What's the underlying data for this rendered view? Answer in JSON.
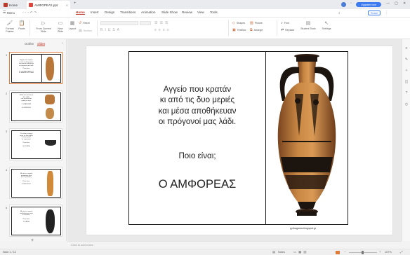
{
  "titlebar": {
    "home_tab": "Home",
    "doc_tab": "ΑΜΦΟΡΕΑΣ.ppt",
    "upgrade": "Upgrade now",
    "colors": {
      "accent": "#c0392b",
      "doc_icon": "#e0443b",
      "upgrade_bg": "#3c7bf0"
    }
  },
  "menubar": {
    "menu": "Menu",
    "tabs": [
      "Home",
      "Insert",
      "Design",
      "Transitions",
      "Animation",
      "Slide Show",
      "Review",
      "View",
      "Tools"
    ],
    "active_tab": "Home",
    "share": "Share"
  },
  "ribbon": {
    "format_painter": "Format Painter",
    "paste": "Paste",
    "from_current_slide": "From Current Slide",
    "new_slide": "New Slide",
    "layout": "Layout",
    "reset": "Reset",
    "section": "Section",
    "shapes": "Shapes",
    "textbox": "TextBox",
    "picture": "Picture",
    "arrange": "Arrange",
    "find": "Find",
    "replace": "Replace",
    "student_tools": "Student Tools",
    "settings": "Settings"
  },
  "leftpanel": {
    "tabs": [
      "Outline",
      "Slides"
    ],
    "active_tab": "Slides",
    "thumbnails": [
      {
        "num": "1",
        "lines": [
          "Αγγείο που κρατάν",
          "κι από τις δυο μεριές",
          "και μέσα αποθήκευαν",
          "οι πρόγονοί μας λάδι.",
          "Ποιο είναι;",
          "Ο ΑΜΦΟΡΕΑΣ"
        ]
      },
      {
        "num": "2",
        "lines": [
          "Βαθύ σαν κούπα με",
          "δυο λαβές",
          "εκεί ανακάτευαν",
          "κρασί με νερό.",
          "Ο ΚΡΑΤΗΡΑΣ",
          "Η ΟΙΝΟΧΟΗ"
        ]
      },
      {
        "num": "3",
        "lines": [
          "Σε κύλικα, ανοιχτό",
          "ρηχό, με δυο λαβές",
          "έπιναν κρασί",
          "σε συμπόσια.",
          "Ποιο είναι;",
          "Η ΚΥΛΙΚΑ"
        ]
      },
      {
        "num": "4",
        "lines": [
          "Με αυτό το αγγείο",
          "μετέφεραν νερό",
          "από τις βρύσες.",
          "Ποιο είναι;",
          "Η ΛΗΚΥΘΟΣ"
        ]
      },
      {
        "num": "5",
        "lines": [
          "Με αυτό το αγγείο",
          "κουβαλούσαν νερό",
          "οι γυναίκες.",
          "Ποιο είναι;",
          "Η ΥΔΡΙΑ"
        ]
      }
    ],
    "add": "+"
  },
  "slide": {
    "poem_lines": [
      "Αγγείο που κρατάν",
      "κι από τις δυο μεριές",
      "και μέσα αποθήκευαν",
      "οι πρόγονοί μας λάδι."
    ],
    "question": "Ποιο είναι;",
    "answer": "Ο ΑΜΦΟΡΕΑΣ",
    "credit": "pythagoras.blogspot.gr"
  },
  "notes": {
    "placeholder": "Click to add notes"
  },
  "statusbar": {
    "slide_info": "Slide 1 / 12",
    "notes": "Notes",
    "zoom": "107%"
  }
}
